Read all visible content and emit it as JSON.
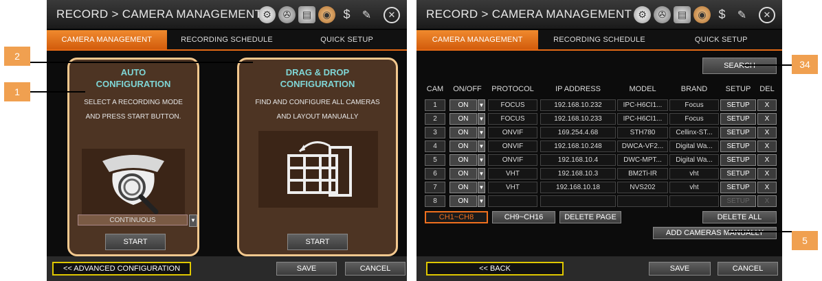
{
  "left": {
    "title": "RECORD > CAMERA MANAGEMENT",
    "tabs": [
      "CAMERA MANAGEMENT",
      "RECORDING SCHEDULE",
      "QUICK SETUP"
    ],
    "auto": {
      "title_line1": "AUTO",
      "title_line2": "CONFIGURATION",
      "desc_line1": "SELECT A RECORDING MODE",
      "desc_line2": "AND PRESS START BUTTON.",
      "mode": "CONTINUOUS",
      "start": "START"
    },
    "drag": {
      "title_line1": "DRAG & DROP",
      "title_line2": "CONFIGURATION",
      "desc_line1": "FIND AND CONFIGURE ALL CAMERAS",
      "desc_line2": "AND LAYOUT MANUALLY",
      "start": "START"
    },
    "advanced": "<< ADVANCED CONFIGURATION",
    "save": "SAVE",
    "cancel": "CANCEL"
  },
  "right": {
    "title": "RECORD > CAMERA MANAGEMENT",
    "tabs": [
      "CAMERA MANAGEMENT",
      "RECORDING SCHEDULE",
      "QUICK SETUP"
    ],
    "search": "SEARCH",
    "headers": {
      "cam": "CAM",
      "onoff": "ON/OFF",
      "protocol": "PROTOCOL",
      "ip": "IP ADDRESS",
      "model": "MODEL",
      "brand": "BRAND",
      "setup": "SETUP",
      "del": "DEL"
    },
    "rows": [
      {
        "cam": "1",
        "on": "ON",
        "protocol": "FOCUS",
        "ip": "192.168.10.232",
        "model": "IPC-H6CI1...",
        "brand": "Focus",
        "setup": "SETUP",
        "del": "X"
      },
      {
        "cam": "2",
        "on": "ON",
        "protocol": "FOCUS",
        "ip": "192.168.10.233",
        "model": "IPC-H6CI1...",
        "brand": "Focus",
        "setup": "SETUP",
        "del": "X"
      },
      {
        "cam": "3",
        "on": "ON",
        "protocol": "ONVIF",
        "ip": "169.254.4.68",
        "model": "STH780",
        "brand": "Cellinx-ST...",
        "setup": "SETUP",
        "del": "X"
      },
      {
        "cam": "4",
        "on": "ON",
        "protocol": "ONVIF",
        "ip": "192.168.10.248",
        "model": "DWCA-VF2...",
        "brand": "Digital Wa...",
        "setup": "SETUP",
        "del": "X"
      },
      {
        "cam": "5",
        "on": "ON",
        "protocol": "ONVIF",
        "ip": "192.168.10.4",
        "model": "DWC-MPT...",
        "brand": "Digital Wa...",
        "setup": "SETUP",
        "del": "X"
      },
      {
        "cam": "6",
        "on": "ON",
        "protocol": "VHT",
        "ip": "192.168.10.3",
        "model": "BM2Ti-IR",
        "brand": "vht",
        "setup": "SETUP",
        "del": "X"
      },
      {
        "cam": "7",
        "on": "ON",
        "protocol": "VHT",
        "ip": "192.168.10.18",
        "model": "NVS202",
        "brand": "vht",
        "setup": "SETUP",
        "del": "X"
      },
      {
        "cam": "8",
        "on": "ON",
        "protocol": "",
        "ip": "",
        "model": "",
        "brand": "",
        "setup": "SETUP",
        "del": "X"
      }
    ],
    "page1": "CH1~CH8",
    "page2": "CH9~CH16",
    "delete_page": "DELETE PAGE",
    "delete_all": "DELETE ALL",
    "add_manually": "ADD CAMERAS MANUALLY",
    "back": "<< BACK",
    "save": "SAVE",
    "cancel": "CANCEL"
  },
  "callouts": {
    "c1": "1",
    "c2": "2",
    "c34": "34",
    "c5": "5"
  },
  "icons": [
    "gear-icon",
    "tape-icon",
    "disk-icon",
    "camera-icon",
    "dollar-icon",
    "pen-icon",
    "close-icon",
    "dropdown-arrow-icon",
    "dome-camera-search-icon",
    "grid-layout-icon"
  ],
  "colors": {
    "accent": "#e56a15",
    "callout": "#f0a050",
    "box_border": "#f4c98f",
    "cfg_title": "#7fd6d6"
  }
}
